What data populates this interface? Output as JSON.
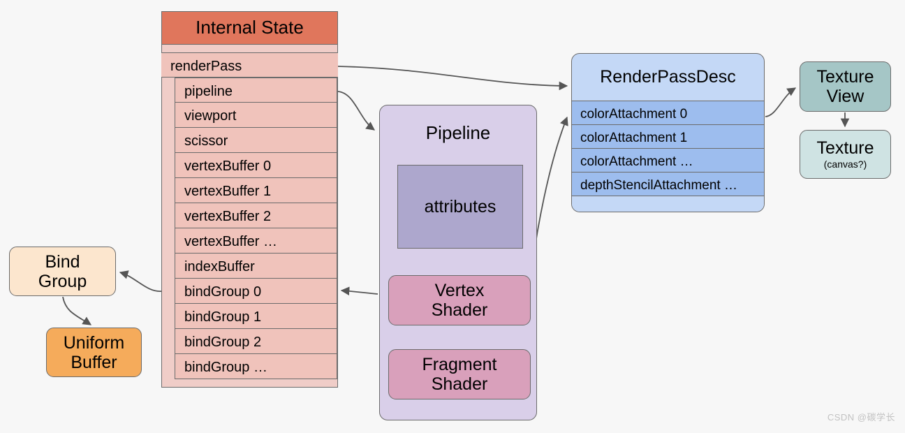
{
  "background_color": "#f7f7f7",
  "colors": {
    "internal_state_title": "#e0765c",
    "internal_state_body": "#f0cdc8",
    "internal_state_row": "#f0c3bb",
    "pipeline": "#d9cfe9",
    "attributes": "#ada7cd",
    "shader": "#d9a0bb",
    "renderpassdesc": "#c4d8f6",
    "attachment_row": "#9dbdee",
    "texture_view": "#a5c6c6",
    "texture": "#cfe3e3",
    "bind_group": "#fce6ce",
    "uniform_buffer": "#f5ab5b",
    "stroke": "#6b6b6b"
  },
  "internal_state": {
    "title": "Internal State",
    "top_row": "renderPass",
    "sub_rows": [
      "pipeline",
      "viewport",
      "scissor",
      "vertexBuffer 0",
      "vertexBuffer 1",
      "vertexBuffer 2",
      "vertexBuffer …",
      "indexBuffer",
      "bindGroup 0",
      "bindGroup 1",
      "bindGroup 2",
      "bindGroup …"
    ]
  },
  "pipeline": {
    "title": "Pipeline",
    "attributes": "attributes",
    "vertex_shader_line1": "Vertex",
    "vertex_shader_line2": "Shader",
    "fragment_shader_line1": "Fragment",
    "fragment_shader_line2": "Shader"
  },
  "renderpassdesc": {
    "title": "RenderPassDesc",
    "attachments": [
      "colorAttachment 0",
      "colorAttachment 1",
      "colorAttachment …",
      "depthStencilAttachment …"
    ]
  },
  "texture_view": {
    "line1": "Texture",
    "line2": "View"
  },
  "texture": {
    "line1": "Texture",
    "note": "(canvas?)"
  },
  "bind_group": {
    "line1": "Bind",
    "line2": "Group"
  },
  "uniform_buffer": {
    "line1": "Uniform",
    "line2": "Buffer"
  },
  "watermark": "CSDN @碳学长"
}
